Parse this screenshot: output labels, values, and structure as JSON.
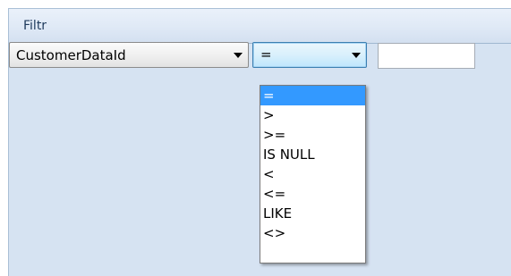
{
  "panel": {
    "title": "Filtr"
  },
  "filter": {
    "field": {
      "selected": "CustomerDataId"
    },
    "operator": {
      "selected": "=",
      "options": [
        "=",
        ">",
        ">=",
        "IS NULL",
        "<",
        "<=",
        "LIKE",
        "<>"
      ],
      "highlighted_index": 0
    },
    "value": {
      "text": ""
    }
  },
  "colors": {
    "panel_background": "#d6e3f2",
    "highlight": "#3399ff"
  }
}
